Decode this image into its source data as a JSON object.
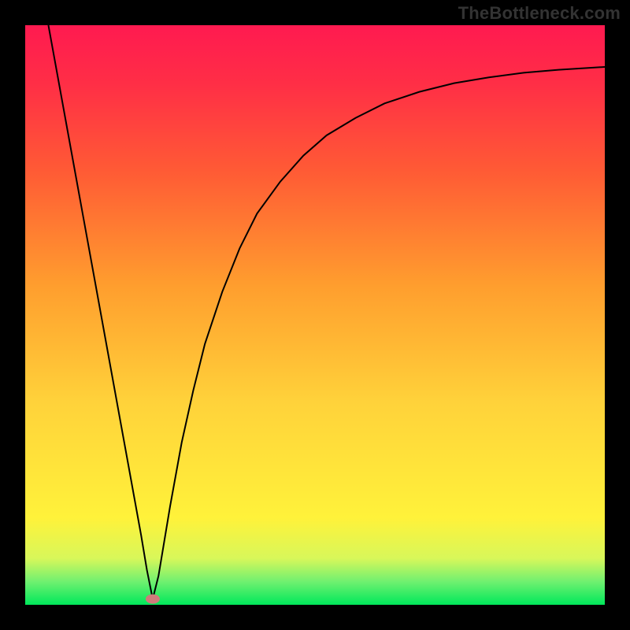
{
  "site": {
    "label": "TheBottleneck.com"
  },
  "chart_data": {
    "type": "line",
    "title": "",
    "xlabel": "",
    "ylabel": "",
    "xlim": [
      0,
      100
    ],
    "ylim": [
      0,
      100
    ],
    "grid": false,
    "axes_visible": false,
    "background_gradient": {
      "stops": [
        {
          "pos": 0.0,
          "color": "#00e85b"
        },
        {
          "pos": 0.04,
          "color": "#70f070"
        },
        {
          "pos": 0.08,
          "color": "#d8f75a"
        },
        {
          "pos": 0.15,
          "color": "#fff23a"
        },
        {
          "pos": 0.35,
          "color": "#ffd23a"
        },
        {
          "pos": 0.55,
          "color": "#ff9e2e"
        },
        {
          "pos": 0.75,
          "color": "#ff5a35"
        },
        {
          "pos": 0.9,
          "color": "#ff2e46"
        },
        {
          "pos": 1.0,
          "color": "#ff1a50"
        }
      ]
    },
    "marker": {
      "x": 22,
      "y": 1,
      "color": "#cf7b7b"
    },
    "series": [
      {
        "name": "curve",
        "stroke": "#000000",
        "points": [
          {
            "x": 4.0,
            "y": 100.0
          },
          {
            "x": 6.0,
            "y": 89.0
          },
          {
            "x": 8.0,
            "y": 78.0
          },
          {
            "x": 10.0,
            "y": 67.0
          },
          {
            "x": 12.0,
            "y": 56.0
          },
          {
            "x": 14.0,
            "y": 45.0
          },
          {
            "x": 16.0,
            "y": 34.0
          },
          {
            "x": 18.0,
            "y": 23.0
          },
          {
            "x": 20.0,
            "y": 12.0
          },
          {
            "x": 21.0,
            "y": 6.0
          },
          {
            "x": 22.0,
            "y": 1.0
          },
          {
            "x": 23.0,
            "y": 5.0
          },
          {
            "x": 24.0,
            "y": 11.0
          },
          {
            "x": 25.0,
            "y": 17.0
          },
          {
            "x": 27.0,
            "y": 28.0
          },
          {
            "x": 29.0,
            "y": 37.0
          },
          {
            "x": 31.0,
            "y": 45.0
          },
          {
            "x": 34.0,
            "y": 54.0
          },
          {
            "x": 37.0,
            "y": 61.5
          },
          {
            "x": 40.0,
            "y": 67.5
          },
          {
            "x": 44.0,
            "y": 73.0
          },
          {
            "x": 48.0,
            "y": 77.5
          },
          {
            "x": 52.0,
            "y": 81.0
          },
          {
            "x": 57.0,
            "y": 84.0
          },
          {
            "x": 62.0,
            "y": 86.5
          },
          {
            "x": 68.0,
            "y": 88.5
          },
          {
            "x": 74.0,
            "y": 90.0
          },
          {
            "x": 80.0,
            "y": 91.0
          },
          {
            "x": 86.0,
            "y": 91.8
          },
          {
            "x": 92.0,
            "y": 92.3
          },
          {
            "x": 100.0,
            "y": 92.8
          }
        ]
      }
    ]
  }
}
